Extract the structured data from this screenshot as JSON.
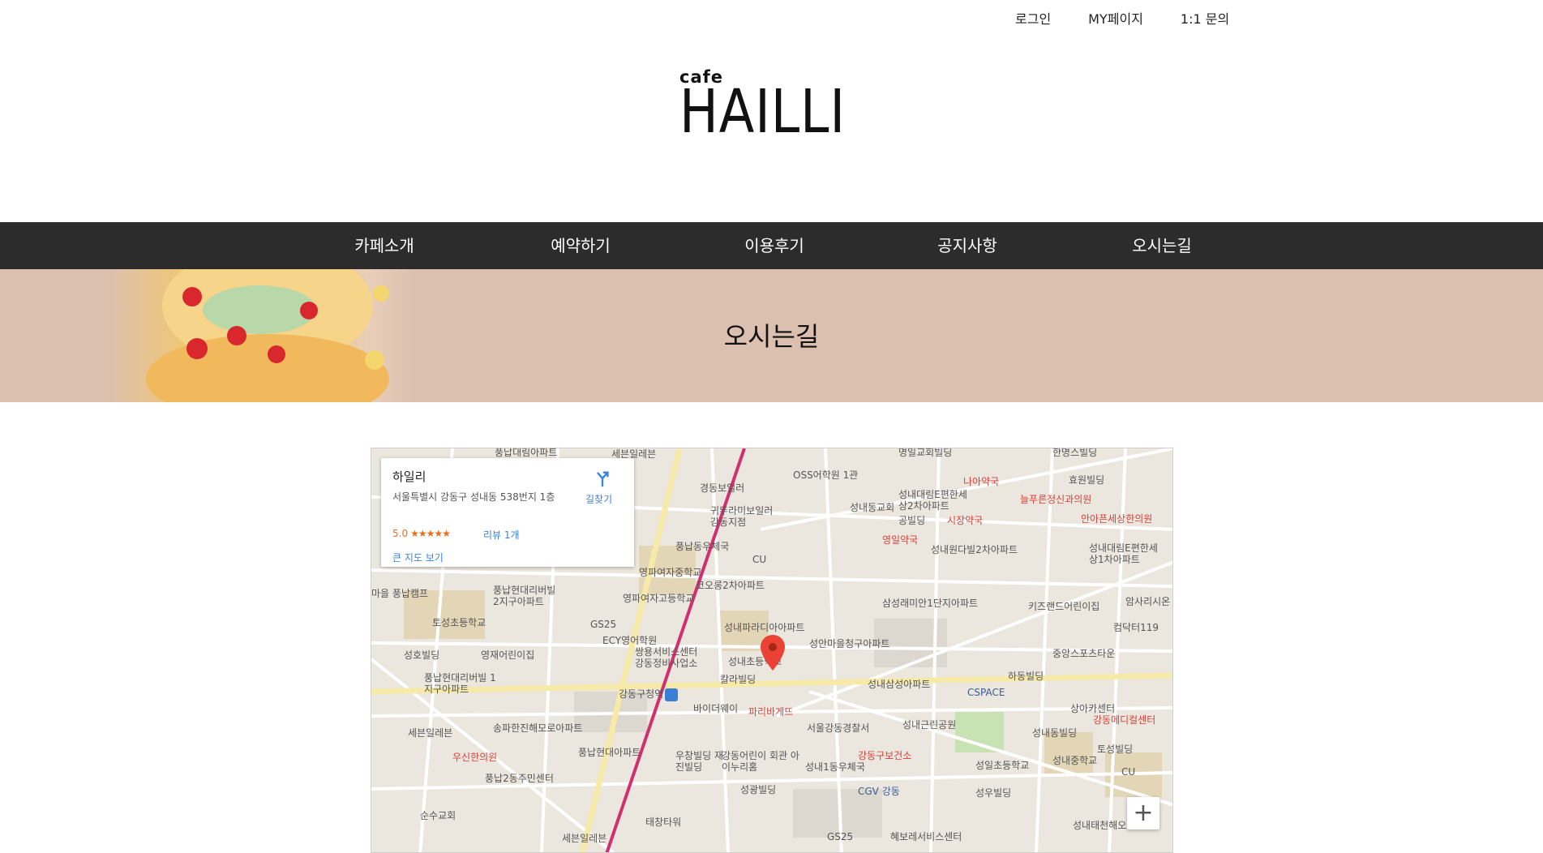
{
  "top_links": [
    "로그인",
    "MY페이지",
    "1:1 문의"
  ],
  "logo": {
    "small": "cafe",
    "big": "HAILLI"
  },
  "nav": [
    "카페소개",
    "예약하기",
    "이용후기",
    "공지사항",
    "오시는길"
  ],
  "banner": {
    "title": "오시는길"
  },
  "map": {
    "card": {
      "place_name": "하일리",
      "address": "서울특별시 강동구 성내동 538번지 1층",
      "rating": "5.0",
      "stars": "★★★★★",
      "reviews": "리뷰 1개",
      "big_map": "큰 지도 보기",
      "directions": "길찾기"
    },
    "zoom_in": "+",
    "labels": [
      "풍납대림아파트",
      "세븐일레븐",
      "OSS어학원 1관",
      "나아약국",
      "효원빌딩",
      "명일교회빌딩",
      "한명스빌딩",
      "경동보일러",
      "성내동교회",
      "성내대림E편한세상2차아파트",
      "늘푸른정신과의원",
      "안아픈세상한의원",
      "귀뚜라미보일러 강동지점",
      "공빌딩",
      "시장약국",
      "영일약국",
      "성내원다빌2차아파트",
      "성내대림E편한세상1차아파트",
      "풍납동우체국",
      "CU",
      "영파여자중학교",
      "코오롱2차아파트",
      "마을 풍납캠프",
      "풍납현대리버빌 2지구아파트",
      "영파여자고등학교",
      "삼성래미안1단지아파트",
      "키즈랜드어린이집",
      "암사리시온",
      "토성초등학교",
      "GS25",
      "성내파라디아아파트",
      "컴닥터119",
      "ECY영어학원",
      "성안마을청구아파트",
      "중앙스포츠타운",
      "성호빌딩",
      "영재어린이집",
      "쌍용서비스센터 강동정비사업소",
      "성내초등학교",
      "하동빌딩",
      "풍납현대리버빌 1지구아파트",
      "칼라빌딩",
      "성내삼성아파트",
      "CSPACE",
      "강동구청역",
      "바이더웨이",
      "상아카센터",
      "강동메디컬센터",
      "파리바게뜨",
      "서울강동경찰서",
      "성내근린공원",
      "세븐일레븐",
      "송파한진해모로아파트",
      "성내동빌딩",
      "풍납현대아파트",
      "강동구보건소",
      "토성빌딩",
      "우신한의원",
      "우창빌딩 재진빌딩",
      "강동어린이 회관 아이누리홈",
      "성내1동우체국",
      "성일초등학교",
      "성내중학교",
      "풍납2동주민센터",
      "성광빌딩",
      "CGV 강동",
      "성우빌딩",
      "CU",
      "순수교회",
      "태창타워",
      "세븐일레븐",
      "GS25",
      "혜보레서비스센터",
      "성내태천해오"
    ]
  }
}
